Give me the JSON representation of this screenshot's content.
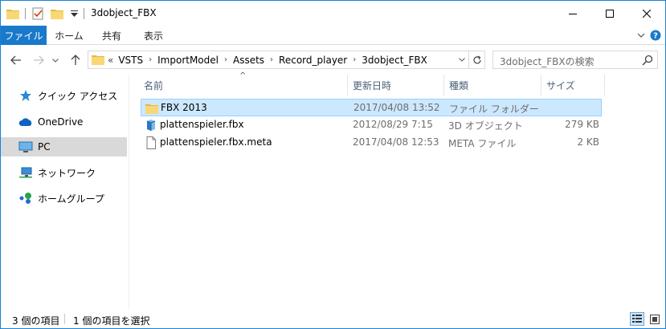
{
  "window": {
    "title": "3dobject_FBX",
    "accent": "#1979ca"
  },
  "ribbon": {
    "tabs": [
      {
        "label": "ファイル"
      },
      {
        "label": "ホーム"
      },
      {
        "label": "共有"
      },
      {
        "label": "表示"
      }
    ]
  },
  "address": {
    "overflow": "«",
    "crumbs": [
      "VSTS",
      "ImportModel",
      "Assets",
      "Record_player",
      "3dobject_FBX"
    ]
  },
  "search": {
    "placeholder": "3dobject_FBXの検索"
  },
  "sidebar": {
    "items": [
      {
        "label": "クイック アクセス",
        "icon": "quick-access-star-icon"
      },
      {
        "label": "OneDrive",
        "icon": "onedrive-cloud-icon"
      },
      {
        "label": "PC",
        "icon": "pc-monitor-icon",
        "selected": true
      },
      {
        "label": "ネットワーク",
        "icon": "network-icon"
      },
      {
        "label": "ホームグループ",
        "icon": "homegroup-icon"
      }
    ]
  },
  "columns": {
    "name": "名前",
    "date": "更新日時",
    "type": "種類",
    "size": "サイズ"
  },
  "files": [
    {
      "name": "FBX 2013",
      "date": "2017/04/08 13:52",
      "type": "ファイル フォルダー",
      "size": "",
      "icon": "folder-icon",
      "selected": true
    },
    {
      "name": "plattenspieler.fbx",
      "date": "2012/08/29 7:15",
      "type": "3D オブジェクト",
      "size": "279 KB",
      "icon": "3d-object-file-icon"
    },
    {
      "name": "plattenspieler.fbx.meta",
      "date": "2017/04/08 12:53",
      "type": "META ファイル",
      "size": "2 KB",
      "icon": "generic-file-icon"
    }
  ],
  "status": {
    "item_count": "3 個の項目",
    "selected_count": "1 個の項目を選択"
  }
}
